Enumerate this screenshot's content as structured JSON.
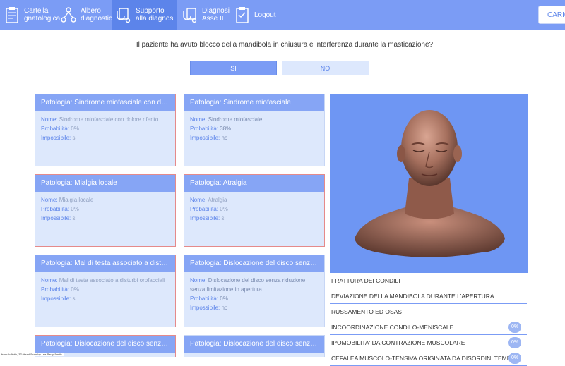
{
  "nav": [
    {
      "label": "Cartella\ngnatologica",
      "icon": "clipboard-icon"
    },
    {
      "label": "Albero\ndiagnostico",
      "icon": "tree-icon"
    },
    {
      "label": "Supporto\nalla diagnosi",
      "icon": "diagnosis-support-icon",
      "active": true
    },
    {
      "label": "Diagnosi\nAsse II",
      "icon": "diagnosis-axis-icon"
    },
    {
      "label": "Logout",
      "icon": "logout-icon"
    }
  ],
  "load_button": "CARIC",
  "question": "Il paziente ha avuto blocco della mandibola in chiusura e interferenza durante la masticazione?",
  "answers": {
    "yes": "SI",
    "no": "NO"
  },
  "field_labels": {
    "name": "Nome:",
    "prob": "Probabilità:",
    "impossible": "Impossibile:"
  },
  "cards": [
    {
      "header": "Patologia: Sindrome miofasciale con dolore riferito",
      "name": "Sindrome miofasciale con dolore riferito",
      "prob": "0%",
      "impossible": "si"
    },
    {
      "header": "Patologia: Sindrome miofasciale",
      "name": "Sindrome miofasciale",
      "prob": "38%",
      "impossible": "no"
    },
    {
      "header": "Patologia: Mialgia locale",
      "name": "Mialgia locale",
      "prob": "0%",
      "impossible": "si"
    },
    {
      "header": "Patologia: Atralgia",
      "name": "Atralgia",
      "prob": "0%",
      "impossible": "si"
    },
    {
      "header": "Patologia: Mal di testa associato a disturbi orofacciali",
      "name": "Mal di testa associato a disturbi orofacciali",
      "prob": "0%",
      "impossible": "si"
    },
    {
      "header": "Patologia: Dislocazione del disco senza riduzione senza limitazione in apertura",
      "name": "Dislocazione del disco senza riduzione senza limitazione in apertura",
      "prob": "0%",
      "impossible": "no"
    },
    {
      "header": "Patologia: Dislocazione del disco senza riduzione",
      "name": "",
      "prob": "",
      "impossible": ""
    },
    {
      "header": "Patologia: Dislocazione del disco senza riduzione",
      "name": "",
      "prob": "",
      "impossible": ""
    }
  ],
  "symptoms": [
    {
      "label": "FRATTURA DEI CONDILI",
      "pct": ""
    },
    {
      "label": "DEVIAZIONE DELLA MANDIBOLA DURANTE L'APERTURA",
      "pct": ""
    },
    {
      "label": "RUSSAMENTO ED OSAS",
      "pct": ""
    },
    {
      "label": "INCOORDINAZIONE CONDILO-MENISCALE",
      "pct": "0%"
    },
    {
      "label": "IPOMOBILITA' DA CONTRAZIONE MUSCOLARE",
      "pct": "0%"
    },
    {
      "label": "CEFALEA MUSCOLO-TENSIVA ORIGINATA DA DISORDINI TEMPO",
      "pct": "0%"
    }
  ],
  "credit": "from: Infinite, 3D Head Scan by Lee Perry-Smith",
  "colors": {
    "accent": "#7b9cf5",
    "active": "#5c84ea",
    "card_bg": "#dde8fc",
    "impossible_border": "#e58a8a"
  }
}
